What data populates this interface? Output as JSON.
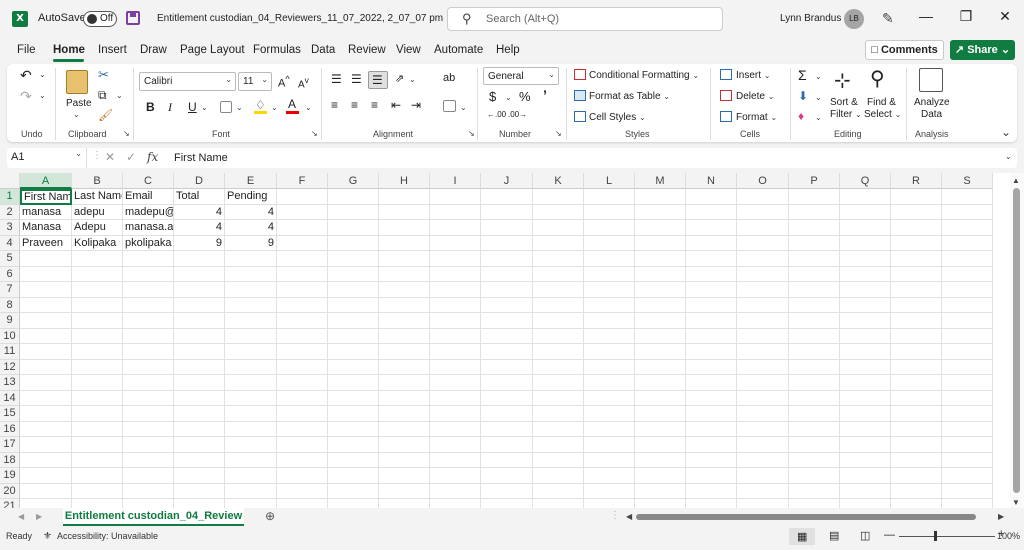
{
  "app": {
    "logo_text": "X",
    "autosave_label": "AutoSave",
    "autosave_state": "Off",
    "document_title": "Entitlement custodian_04_Reviewers_11_07_2022, 2_07_07 pm",
    "search_placeholder": "Search (Alt+Q)",
    "user_name": "Lynn Brandus",
    "user_initials": "LB"
  },
  "menu": {
    "tabs": [
      "File",
      "Home",
      "Insert",
      "Draw",
      "Page Layout",
      "Formulas",
      "Data",
      "Review",
      "View",
      "Automate",
      "Help"
    ],
    "active": "Home",
    "comments_label": "Comments",
    "share_label": "Share"
  },
  "ribbon": {
    "groups": {
      "undo": "Undo",
      "clipboard": "Clipboard",
      "font": "Font",
      "alignment": "Alignment",
      "number": "Number",
      "styles": "Styles",
      "cells": "Cells",
      "editing": "Editing",
      "analysis": "Analysis"
    },
    "paste_label": "Paste",
    "font_name": "Calibri",
    "font_size": "11",
    "number_format": "General",
    "conditional_formatting": "Conditional Formatting",
    "format_as_table": "Format as Table",
    "cell_styles": "Cell Styles",
    "insert": "Insert",
    "delete": "Delete",
    "format": "Format",
    "sort_filter_1": "Sort &",
    "sort_filter_2": "Filter",
    "find_select_1": "Find &",
    "find_select_2": "Select",
    "analyze_1": "Analyze",
    "analyze_2": "Data"
  },
  "formula_bar": {
    "name_box": "A1",
    "fx": "fx",
    "value": "First Name"
  },
  "sheet": {
    "columns": [
      "A",
      "B",
      "C",
      "D",
      "E",
      "F",
      "G",
      "H",
      "I",
      "J",
      "K",
      "L",
      "M",
      "N",
      "O",
      "P",
      "Q",
      "R",
      "S"
    ],
    "row_numbers": [
      "1",
      "2",
      "3",
      "4",
      "5",
      "6",
      "7",
      "8",
      "9",
      "10",
      "11",
      "12",
      "13",
      "14",
      "15",
      "16",
      "17",
      "18",
      "19",
      "20",
      "21"
    ],
    "rows": [
      [
        "First Name",
        "Last Name",
        "Email",
        "Total",
        "Pending"
      ],
      [
        "manasa",
        "adepu",
        "madepu@",
        "4",
        "4"
      ],
      [
        "Manasa",
        "Adepu",
        "manasa.ac",
        "4",
        "4"
      ],
      [
        "Praveen",
        "Kolipaka",
        "pkolipaka",
        "9",
        "9"
      ]
    ],
    "tab_name": "Entitlement custodian_04_Review"
  },
  "status": {
    "ready": "Ready",
    "accessibility": "Accessibility: Unavailable",
    "zoom": "100%"
  },
  "colors": {
    "accent": "#107c41",
    "autosave_purple": "#7a3fa0"
  }
}
